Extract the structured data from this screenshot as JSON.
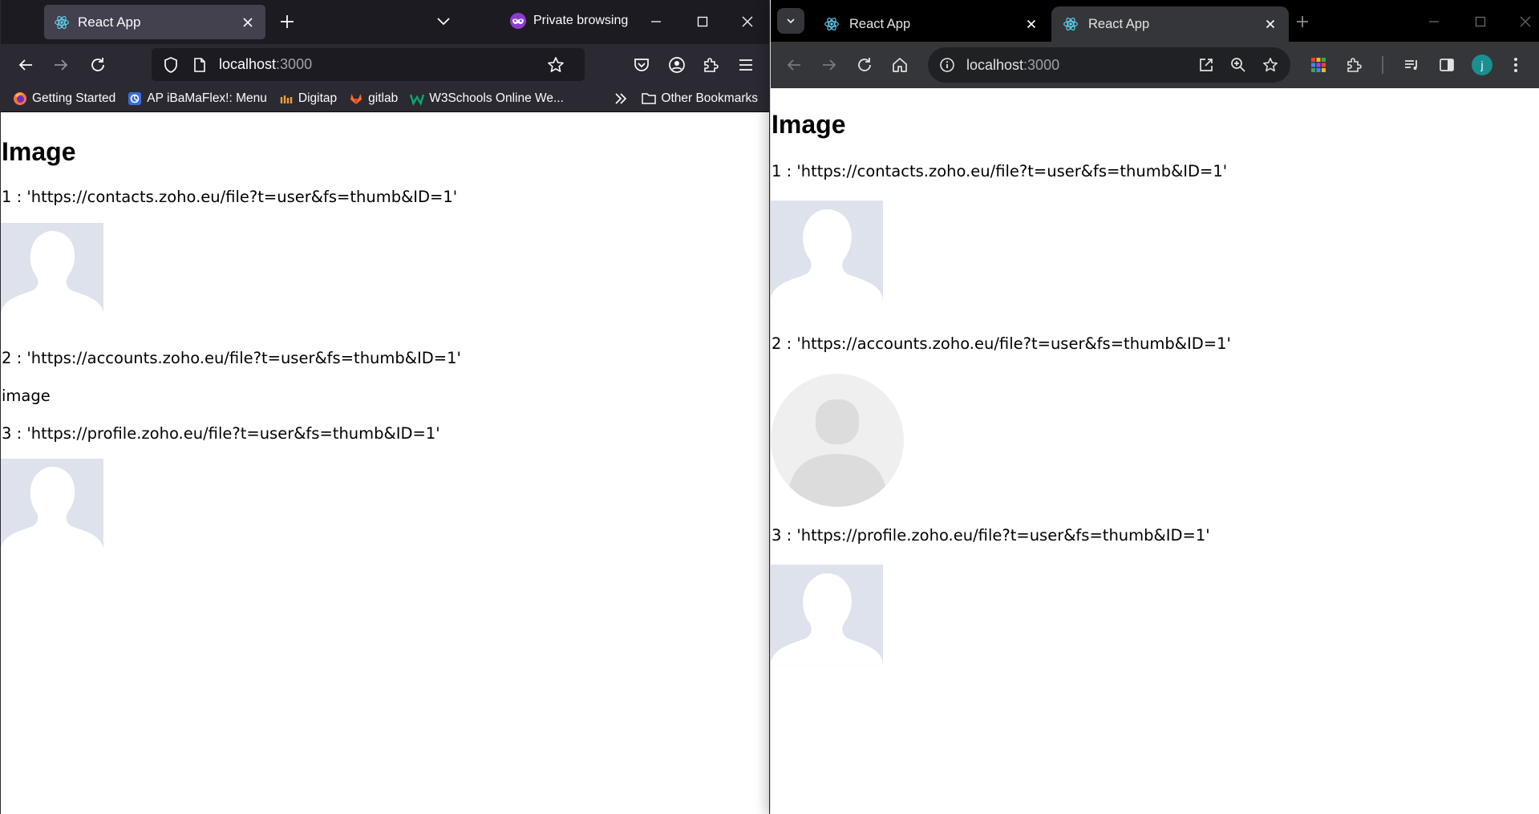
{
  "firefox": {
    "tab": {
      "title": "React App"
    },
    "private_label": "Private browsing",
    "url": {
      "host": "localhost",
      "port": ":3000"
    },
    "bookmarks": [
      {
        "label": "Getting Started",
        "icon": "firefox-icon"
      },
      {
        "label": "AP iBaMaFlex!: Menu",
        "icon": "ap-icon"
      },
      {
        "label": "Digitap",
        "icon": "digitap-icon"
      },
      {
        "label": "gitlab",
        "icon": "gitlab-icon"
      },
      {
        "label": "W3Schools Online We...",
        "icon": "w3schools-icon"
      }
    ],
    "other_bookmarks": "Other Bookmarks",
    "page": {
      "heading": "Image",
      "items": [
        {
          "text": "1 : 'https://contacts.zoho.eu/file?t=user&fs=thumb&ID=1'",
          "image": "silhouette"
        },
        {
          "text": "2 : 'https://accounts.zoho.eu/file?t=user&fs=thumb&ID=1'",
          "image": "broken",
          "alt": "image"
        },
        {
          "text": "3 : 'https://profile.zoho.eu/file?t=user&fs=thumb&ID=1'",
          "image": "silhouette"
        }
      ]
    }
  },
  "chrome": {
    "tabs": [
      {
        "title": "React App",
        "active": false
      },
      {
        "title": "React App",
        "active": true
      }
    ],
    "url": {
      "host": "localhost",
      "port": ":3000"
    },
    "profile_initial": "j",
    "page": {
      "heading": "Image",
      "items": [
        {
          "text": "1 : 'https://contacts.zoho.eu/file?t=user&fs=thumb&ID=1'",
          "image": "silhouette"
        },
        {
          "text": "2 : 'https://accounts.zoho.eu/file?t=user&fs=thumb&ID=1'",
          "image": "round-avatar"
        },
        {
          "text": "3 : 'https://profile.zoho.eu/file?t=user&fs=thumb&ID=1'",
          "image": "silhouette"
        }
      ]
    }
  },
  "colors": {
    "ff_toolbar": "#2b2a33",
    "ff_tabbar": "#1c1b22",
    "chrome_tabbar": "#000000",
    "chrome_toolbar": "#35363a",
    "silhouette_bg": "#dde2ec",
    "silhouette_fg": "#ffffff",
    "avatar_bg": "#efefef",
    "avatar_fg": "#dcdcdc"
  }
}
